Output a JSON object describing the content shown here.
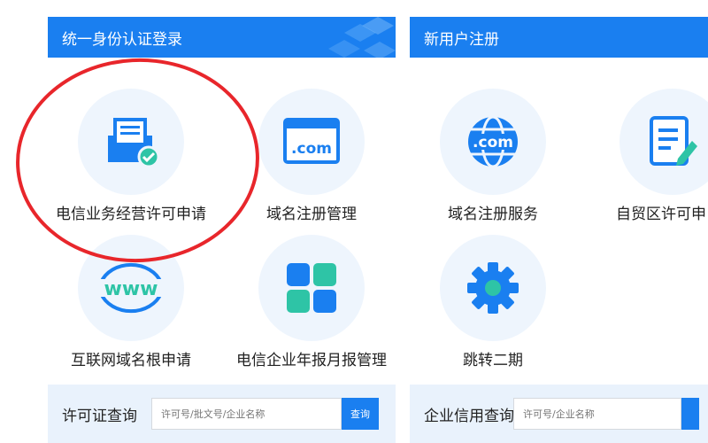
{
  "panels": {
    "login": {
      "title": "统一身份认证登录"
    },
    "register": {
      "title": "新用户注册"
    }
  },
  "tiles": [
    {
      "label": "电信业务经营许可申请",
      "icon": "license-document-check-icon"
    },
    {
      "label": "域名注册管理",
      "icon": "dot-com-browser-icon"
    },
    {
      "label": "域名注册服务",
      "icon": "dot-com-globe-icon"
    },
    {
      "label": "自贸区许可申",
      "icon": "edit-document-icon"
    },
    {
      "label": "互联网域名根申请",
      "icon": "www-icon"
    },
    {
      "label": "电信企业年报月报管理",
      "icon": "grid-blocks-icon"
    },
    {
      "label": "跳转二期",
      "icon": "gear-icon"
    }
  ],
  "search": {
    "license": {
      "label": "许可证查询",
      "placeholder": "许可号/批文号/企业名称",
      "button": "查询"
    },
    "credit": {
      "label": "企业信用查询",
      "placeholder": "许可号/企业名称"
    }
  },
  "colors": {
    "primary": "#1a7ff0",
    "accent": "#2ec4a6",
    "highlight": "#e8262b",
    "tile_bg": "#eef5fd"
  }
}
